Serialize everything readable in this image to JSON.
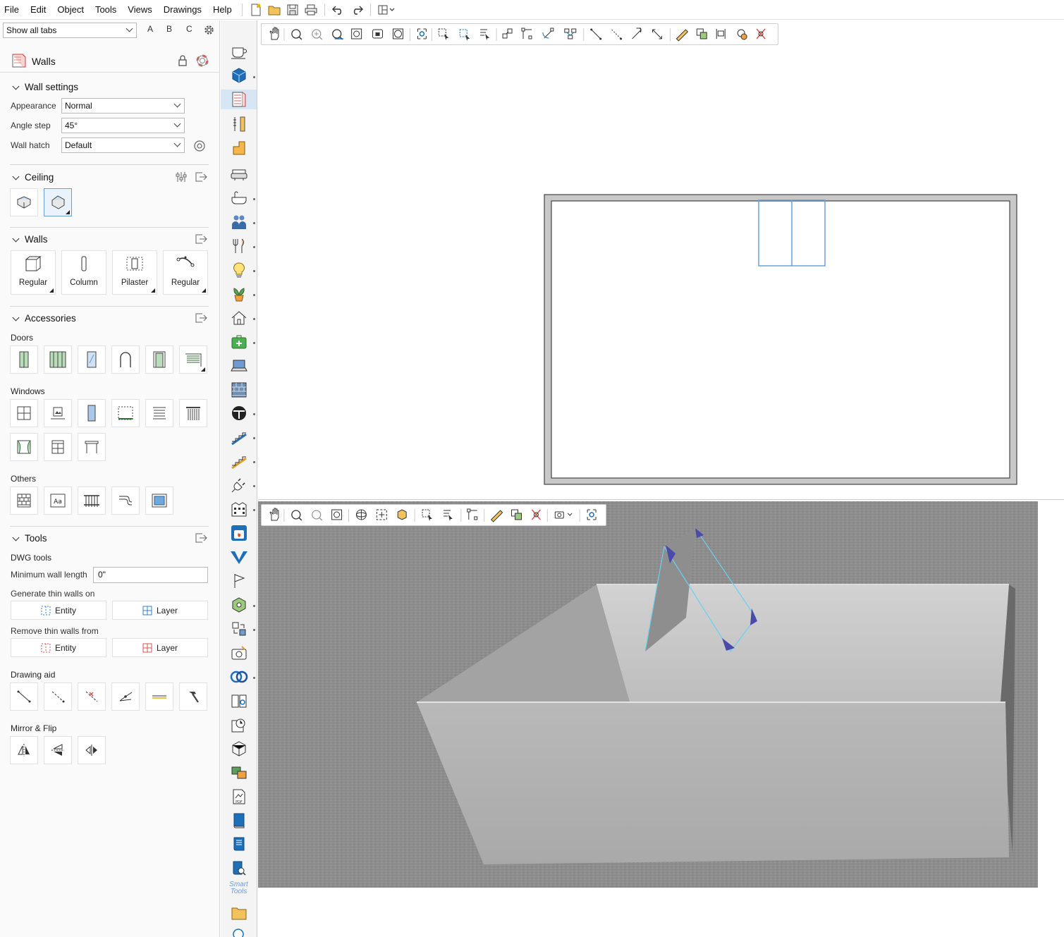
{
  "menubar": {
    "items": [
      "File",
      "Edit",
      "Object",
      "Tools",
      "Views",
      "Drawings",
      "Help"
    ]
  },
  "left_panel": {
    "tab_filter": {
      "value": "Show all tabs",
      "letters": [
        "A",
        "B",
        "C"
      ]
    },
    "header": {
      "title": "Walls"
    },
    "wall_settings": {
      "title": "Wall settings",
      "appearance_label": "Appearance",
      "appearance_value": "Normal",
      "angle_step_label": "Angle step",
      "angle_step_value": "45°",
      "wall_hatch_label": "Wall hatch",
      "wall_hatch_value": "Default"
    },
    "ceiling": {
      "title": "Ceiling"
    },
    "walls": {
      "title": "Walls",
      "buttons": [
        "Regular",
        "Column",
        "Pilaster",
        "Regular"
      ]
    },
    "accessories": {
      "title": "Accessories",
      "doors_label": "Doors",
      "windows_label": "Windows",
      "others_label": "Others"
    },
    "tools": {
      "title": "Tools",
      "dwg_label": "DWG tools",
      "min_wall_label": "Minimum wall length",
      "min_wall_value": "0\"",
      "generate_label": "Generate thin walls on",
      "remove_label": "Remove thin walls from",
      "entity_label": "Entity",
      "layer_label": "Layer",
      "drawing_aid_label": "Drawing aid",
      "mirror_label": "Mirror & Flip"
    }
  },
  "vtoolbar": {
    "smart_tools_label_1": "Smart",
    "smart_tools_label_2": "Tools"
  },
  "colors": {
    "accent_blue": "#2f7fd0",
    "selection_blue": "#6aa0d8",
    "floor_gray": "#8f8f8f",
    "wall_gray": "#b5b5b5"
  }
}
